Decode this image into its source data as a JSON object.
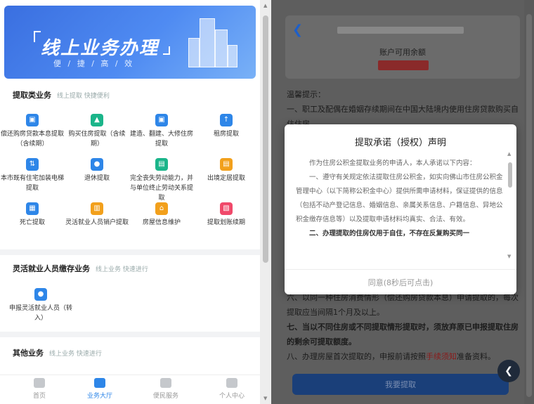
{
  "left": {
    "banner": {
      "title": "线上业务办理",
      "subtitle": "便 / 捷 / 高 / 效"
    },
    "sections": [
      {
        "title": "提取类业务",
        "hint": "线上提取 快捷便利"
      },
      {
        "title": "灵活就业人员缴存业务",
        "hint": "线上业务 快速进行"
      },
      {
        "title": "其他业务",
        "hint": "线上业务 快速进行"
      }
    ],
    "withdraw_items": [
      {
        "label": "偿还购房贷款本息提取（含续期）",
        "icon": "house-icon",
        "color": "blue"
      },
      {
        "label": "购买住房提取（含续期）",
        "icon": "arrow-up-icon",
        "color": "green"
      },
      {
        "label": "建造、翻建、大修住房提取",
        "icon": "house-icon",
        "color": "blue"
      },
      {
        "label": "租房提取",
        "icon": "upload-icon",
        "color": "blue"
      },
      {
        "label": "本市既有住宅加装电梯提取",
        "icon": "elevator-icon",
        "color": "blue"
      },
      {
        "label": "退休提取",
        "icon": "person-icon",
        "color": "blue"
      },
      {
        "label": "完全丧失劳动能力，并与单位终止劳动关系提取",
        "icon": "card-icon",
        "color": "green"
      },
      {
        "label": "出境定居提取",
        "icon": "card-icon",
        "color": "orange"
      },
      {
        "label": "死亡提取",
        "icon": "doc-icon",
        "color": "blue"
      },
      {
        "label": "灵活就业人员销户提取",
        "icon": "lock-icon",
        "color": "orange"
      },
      {
        "label": "房屋信息维护",
        "icon": "home-icon",
        "color": "orange"
      },
      {
        "label": "提取划账续期",
        "icon": "calendar-icon",
        "color": "pink"
      }
    ],
    "flex_items": [
      {
        "label": "申报灵活就业人员（转入）",
        "icon": "person-icon",
        "color": "blue"
      }
    ],
    "nav": [
      {
        "label": "首页",
        "icon": "home-icon",
        "active": false
      },
      {
        "label": "业务大厅",
        "icon": "briefcase-icon",
        "active": true
      },
      {
        "label": "便民服务",
        "icon": "service-icon",
        "active": false
      },
      {
        "label": "个人中心",
        "icon": "user-icon",
        "active": false
      }
    ]
  },
  "right": {
    "balance_label": "账户可用余额",
    "notice_heading": "温馨提示：",
    "notice_1": "一、职工及配偶在婚姻存续期间在中国大陆境内使用住房贷款购买自住住房。",
    "notice_6": "六、以同一种住房消费情形（偿还购房贷款本息）申请提取的，每次提取应当间隔1个月及以上。",
    "notice_7": "七、当以不同住房或不同提取情形提取时，须放弃原已申报提取住房的剩余可提取额度。",
    "notice_8_pre": "八、办理房屋首次提取的，申报前请按照",
    "notice_8_link": "手续须知",
    "notice_8_post": "准备资料。",
    "apply_button": "我要提取",
    "float_icon": "chevron-left-icon"
  },
  "modal": {
    "title": "提取承诺（授权）声明",
    "p1": "作为住房公积金提取业务的申请人，本人承诺以下内容：",
    "p2": "一、遵守有关规定依法提取住房公积金，如实向佛山市住房公积金管理中心（以下简称公积金中心）提供所需申请材料，保证提供的信息（包括不动产登记信息、婚姻信息、亲属关系信息、户籍信息、异地公积金缴存信息等）以及提取申请材料均真实、合法、有效。",
    "p3": "二、办理提取的住房仅用于自住，不存在反复购买同一",
    "agree_button": "同意(8秒后可点击)"
  }
}
